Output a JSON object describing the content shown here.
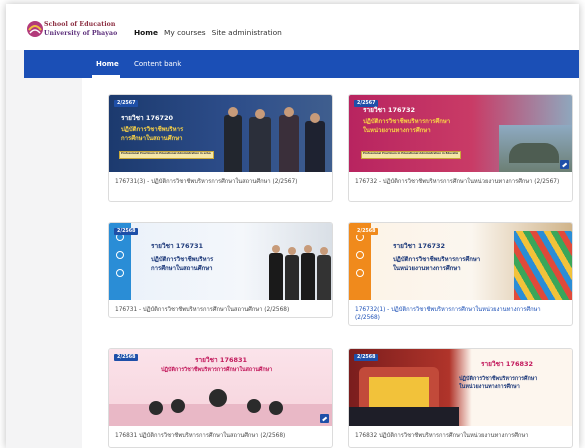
{
  "brand": {
    "line1": "School of Education",
    "line2": "University of Phayao"
  },
  "topnav": {
    "items": [
      "Home",
      "My courses",
      "Site administration"
    ]
  },
  "subnav": {
    "tabs": [
      "Home",
      "Content bank"
    ]
  },
  "courses": [
    {
      "badge": "2/2567",
      "image_title": "รายวิชา 176720",
      "image_subtitle": "ปฏิบัติการวิชาชีพบริหาร\nการศึกษาในสถานศึกษา",
      "image_strip": "Professional Practicum in Educational Administration in schools",
      "caption": "176731(3) - ปฏิบัติการวิชาชีพบริหารการศึกษาในสถานศึกษา (2/2567)"
    },
    {
      "badge": "2/2567",
      "image_title": "รายวิชา 176732",
      "image_subtitle": "ปฏิบัติการวิชาชีพบริหารการศึกษา\nในหน่วยงานทางการศึกษา",
      "image_strip": "Professional Practicum in Educational Administration in Educational Organizations",
      "caption": "176732 - ปฏิบัติการวิชาชีพบริหารการศึกษาในหน่วยงานทางการศึกษา (2/2567)"
    },
    {
      "badge": "2/2568",
      "image_title": "รายวิชา 176731",
      "image_subtitle": "ปฏิบัติการวิชาชีพบริหาร\nการศึกษาในสถานศึกษา",
      "caption": "176731 - ปฏิบัติการวิชาชีพบริหารการศึกษาในสถานศึกษา (2/2568)"
    },
    {
      "badge": "2/2568",
      "image_title": "รายวิชา 176732",
      "image_subtitle": "ปฏิบัติการวิชาชีพบริหารการศึกษา\nในหน่วยงานทางการศึกษา",
      "caption": "176732(1) - ปฏิบัติการวิชาชีพบริหารการศึกษาในหน่วยงานทางการศึกษา (2/2568)"
    },
    {
      "badge": "2/2568",
      "image_title": "รายวิชา 176831",
      "image_subtitle": "ปฏิบัติการวิชาชีพบริหารการศึกษาในสถานศึกษา",
      "caption": "176831 ปฏิบัติการวิชาชีพบริหารการศึกษาในสถานศึกษา (2/2568)"
    },
    {
      "badge": "2/2568",
      "image_title": "รายวิชา 176832",
      "image_subtitle": "ปฏิบัติการวิชาชีพบริหารการศึกษา\nในหน่วยงานทางการศึกษา",
      "caption": "176832 ปฏิบัติการวิชาชีพบริหารการศึกษาในหน่วยงานทางการศึกษา"
    }
  ]
}
